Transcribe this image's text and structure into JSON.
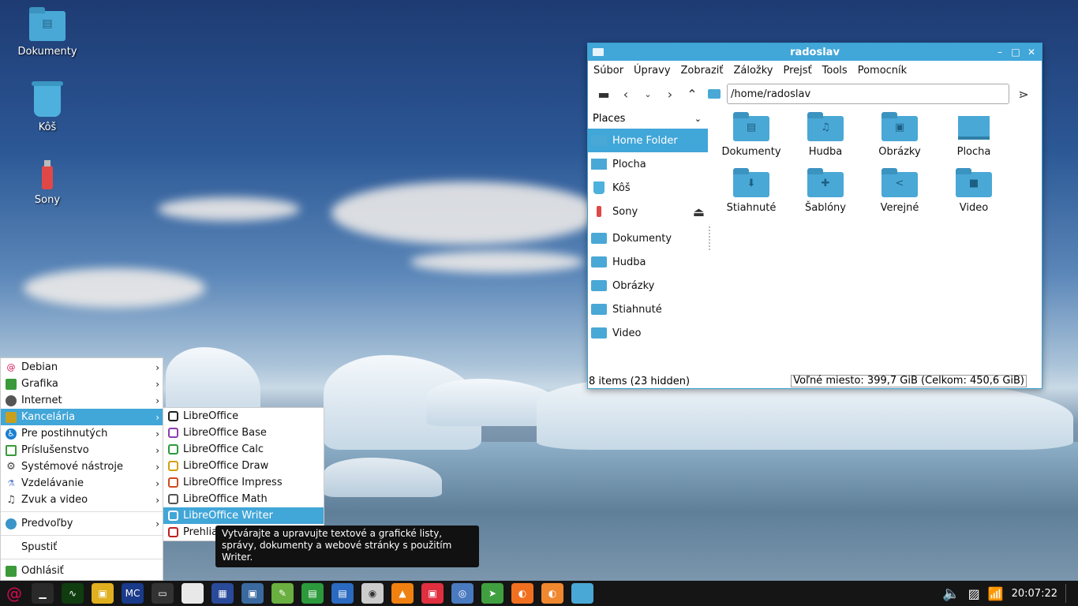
{
  "desktop": {
    "icons": [
      {
        "label": "Dokumenty"
      },
      {
        "label": "Kôš"
      },
      {
        "label": "Sony"
      }
    ]
  },
  "window": {
    "title": "radoslav",
    "controls": {
      "minimize": "–",
      "maximize": "□",
      "close": "✕"
    },
    "menu": [
      "Súbor",
      "Úpravy",
      "Zobraziť",
      "Záložky",
      "Prejsť",
      "Tools",
      "Pomocník"
    ],
    "path": "/home/radoslav",
    "sidebar": {
      "header": "Places",
      "items": [
        {
          "label": "Home Folder"
        },
        {
          "label": "Plocha"
        },
        {
          "label": "Kôš"
        },
        {
          "label": "Sony"
        },
        {
          "label": "Dokumenty"
        },
        {
          "label": "Hudba"
        },
        {
          "label": "Obrázky"
        },
        {
          "label": "Stiahnuté"
        },
        {
          "label": "Video"
        }
      ]
    },
    "files": [
      {
        "label": "Dokumenty",
        "icon": "document-folder-icon",
        "glyph": "▤"
      },
      {
        "label": "Hudba",
        "icon": "music-folder-icon",
        "glyph": "♫"
      },
      {
        "label": "Obrázky",
        "icon": "pictures-folder-icon",
        "glyph": "▣"
      },
      {
        "label": "Plocha",
        "icon": "desktop-icon",
        "glyph": ""
      },
      {
        "label": "Stiahnuté",
        "icon": "downloads-folder-icon",
        "glyph": "⬇"
      },
      {
        "label": "Šablóny",
        "icon": "templates-folder-icon",
        "glyph": "✚"
      },
      {
        "label": "Verejné",
        "icon": "public-folder-icon",
        "glyph": "<"
      },
      {
        "label": "Video",
        "icon": "video-folder-icon",
        "glyph": "■"
      }
    ],
    "status": {
      "items": "8 items (23 hidden)",
      "free": "Voľné miesto: 399,7 GiB (Celkom: 450,6 GiB)"
    }
  },
  "startmenu": {
    "items": [
      {
        "label": "Debian",
        "icon_color": "#d70a53"
      },
      {
        "label": "Grafika",
        "icon_color": "#3a9a3a"
      },
      {
        "label": "Internet",
        "icon_color": "#555555"
      },
      {
        "label": "Kancelária",
        "icon_color": "#c8a020"
      },
      {
        "label": "Pre postihnutých",
        "icon_color": "#1a7fd0"
      },
      {
        "label": "Príslušenstvo",
        "icon_color": "#3a9a3a"
      },
      {
        "label": "Systémové nástroje",
        "icon_color": "#444444"
      },
      {
        "label": "Vzdelávanie",
        "icon_color": "#6a8ad0"
      },
      {
        "label": "Zvuk a video",
        "icon_color": "#444444"
      }
    ],
    "preferences": "Predvoľby",
    "run": "Spustiť",
    "logout": "Odhlásiť"
  },
  "submenu": {
    "items": [
      {
        "label": "LibreOffice",
        "color": "#222222"
      },
      {
        "label": "LibreOffice Base",
        "color": "#8e3cb0"
      },
      {
        "label": "LibreOffice Calc",
        "color": "#2c9a3c"
      },
      {
        "label": "LibreOffice Draw",
        "color": "#d0a010"
      },
      {
        "label": "LibreOffice Impress",
        "color": "#d04a20"
      },
      {
        "label": "LibreOffice Math",
        "color": "#555555"
      },
      {
        "label": "LibreOffice Writer",
        "color": "#2a6ac0"
      },
      {
        "label": "Prehlia",
        "color": "#c02020"
      }
    ]
  },
  "tooltip": "Vytvárajte a upravujte textové a grafické listy, správy, dokumenty a webové stránky s použitím Writer.",
  "taskbar": {
    "clock": "20:07:22",
    "launchers": [
      {
        "name": "system-monitor-icon",
        "bg": "#2a2a2a",
        "glyph": "▁"
      },
      {
        "name": "activity-monitor-icon",
        "bg": "#0f3d0f",
        "glyph": "∿"
      },
      {
        "name": "package-icon",
        "bg": "#e0b020",
        "glyph": "▣"
      },
      {
        "name": "midnight-commander-icon",
        "bg": "#1a3a8a",
        "glyph": "MC"
      },
      {
        "name": "terminal-icon",
        "bg": "#333333",
        "glyph": "▭"
      },
      {
        "name": "blank-document-icon",
        "bg": "#e8e8e8",
        "glyph": ""
      },
      {
        "name": "calculator-icon",
        "bg": "#2a4a9a",
        "glyph": "▦"
      },
      {
        "name": "image-viewer-icon",
        "bg": "#3a6aa0",
        "glyph": "▣"
      },
      {
        "name": "draw-icon",
        "bg": "#6ab040",
        "glyph": "✎"
      },
      {
        "name": "calc-icon",
        "bg": "#2c9a3c",
        "glyph": "▤"
      },
      {
        "name": "writer-icon",
        "bg": "#2a6ac0",
        "glyph": "▤"
      },
      {
        "name": "disc-icon",
        "bg": "#cccccc",
        "glyph": "◉"
      },
      {
        "name": "vlc-icon",
        "bg": "#f08010",
        "glyph": "▲"
      },
      {
        "name": "store-icon",
        "bg": "#e03040",
        "glyph": "▣"
      },
      {
        "name": "chromium-icon",
        "bg": "#4a7ac0",
        "glyph": "◎"
      },
      {
        "name": "feed-icon",
        "bg": "#40a040",
        "glyph": "➤"
      },
      {
        "name": "firefox-icon",
        "bg": "#f07020",
        "glyph": "◐"
      },
      {
        "name": "firefox-alt-icon",
        "bg": "#f08830",
        "glyph": "◐"
      },
      {
        "name": "file-manager-icon",
        "bg": "#49a8d6",
        "glyph": ""
      }
    ]
  }
}
